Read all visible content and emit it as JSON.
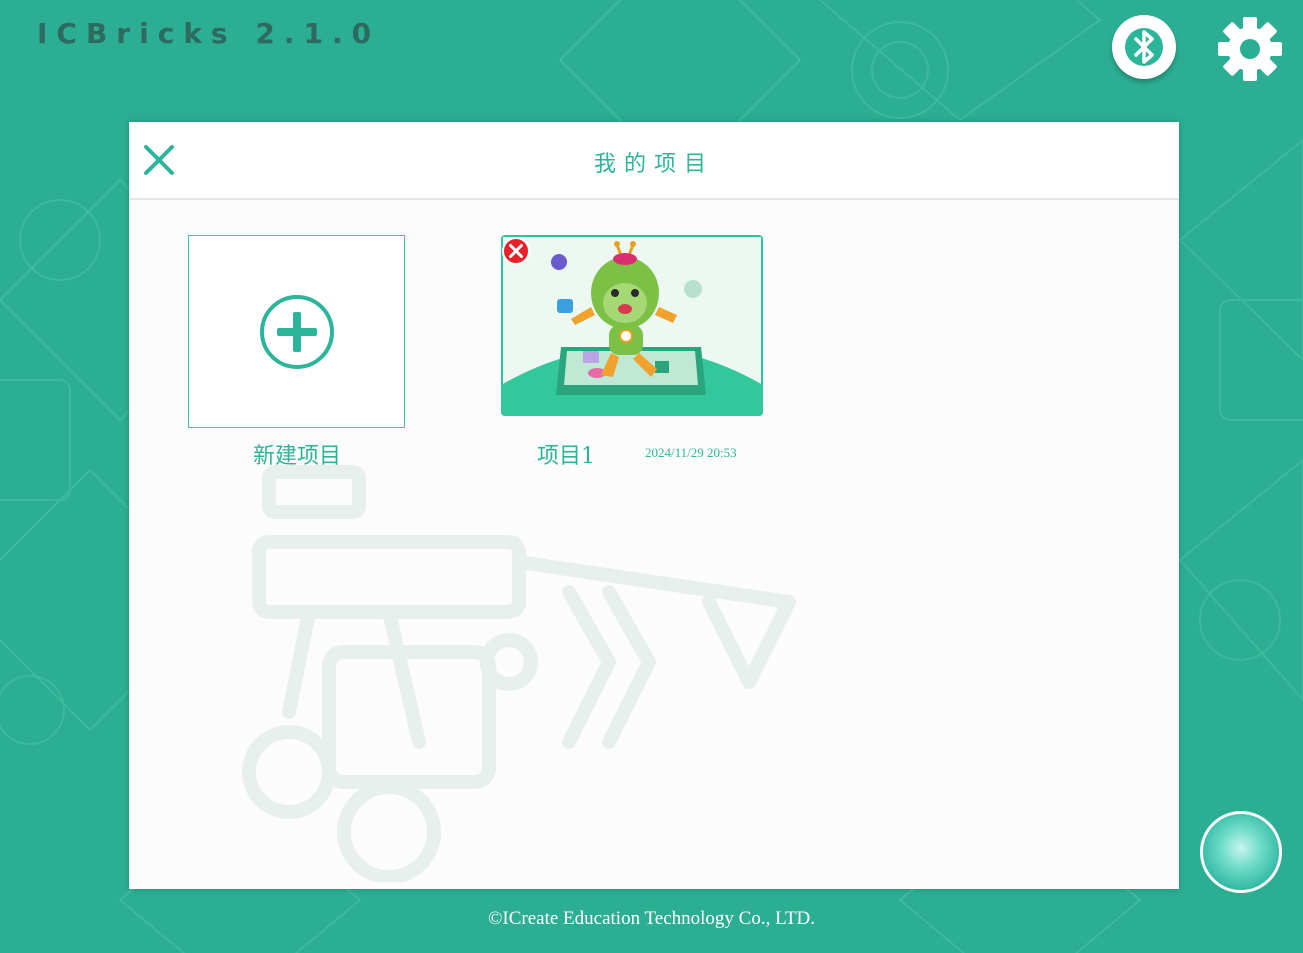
{
  "app": {
    "title": "ICBricks  2.1.0"
  },
  "toolbar": {
    "bluetooth_icon": "bluetooth-icon",
    "settings_icon": "gear-icon"
  },
  "dialog": {
    "title": "我的项目",
    "close_icon": "close-icon",
    "new_project_label": "新建项目",
    "new_project_icon": "plus-circle-icon",
    "projects": [
      {
        "name": "项目1",
        "date": "2024/11/29 20:53",
        "delete_icon": "delete-icon"
      }
    ]
  },
  "footer": {
    "copyright": "©ICreate Education Technology Co., LTD."
  },
  "colors": {
    "background": "#2bae93",
    "accent": "#2bb59b",
    "panel": "#fcfcfc",
    "delete": "#e8202a"
  }
}
